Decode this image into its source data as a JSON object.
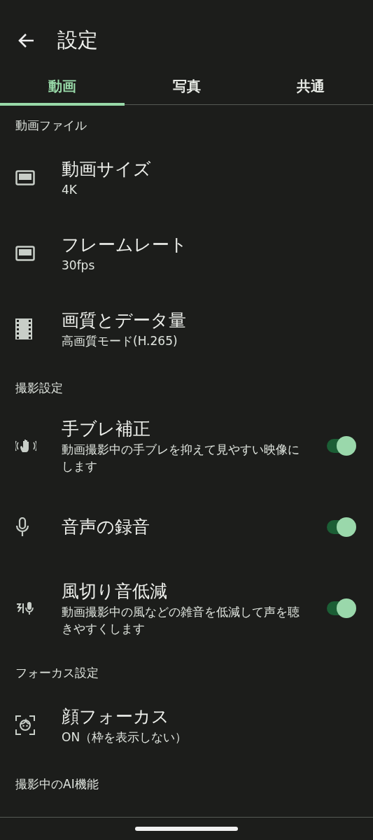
{
  "app_bar": {
    "title": "設定"
  },
  "tabs": [
    {
      "label": "動画",
      "selected": true
    },
    {
      "label": "写真",
      "selected": false
    },
    {
      "label": "共通",
      "selected": false
    }
  ],
  "sections": [
    {
      "header": "動画ファイル",
      "items": [
        {
          "kind": "value",
          "title": "動画サイズ",
          "summary": "4K"
        },
        {
          "kind": "value",
          "title": "フレームレート",
          "summary": "30fps"
        },
        {
          "kind": "value",
          "title": "画質とデータ量",
          "summary": "高画質モード(H.265)"
        }
      ]
    },
    {
      "header": "撮影設定",
      "items": [
        {
          "kind": "toggle",
          "title": "手ブレ補正",
          "summary": "動画撮影中の手ブレを抑えて見やすい映像にします",
          "on": true
        },
        {
          "kind": "toggle",
          "title": "音声の録音",
          "on": true
        },
        {
          "kind": "toggle",
          "title": "風切り音低減",
          "summary": "動画撮影中の風などの雑音を低減して声を聴きやすくします",
          "on": true
        }
      ]
    },
    {
      "header": "フォーカス設定",
      "items": [
        {
          "kind": "value",
          "title": "顔フォーカス",
          "summary": "ON（枠を表示しない）"
        }
      ]
    },
    {
      "header": "撮影中のAI機能"
    }
  ]
}
